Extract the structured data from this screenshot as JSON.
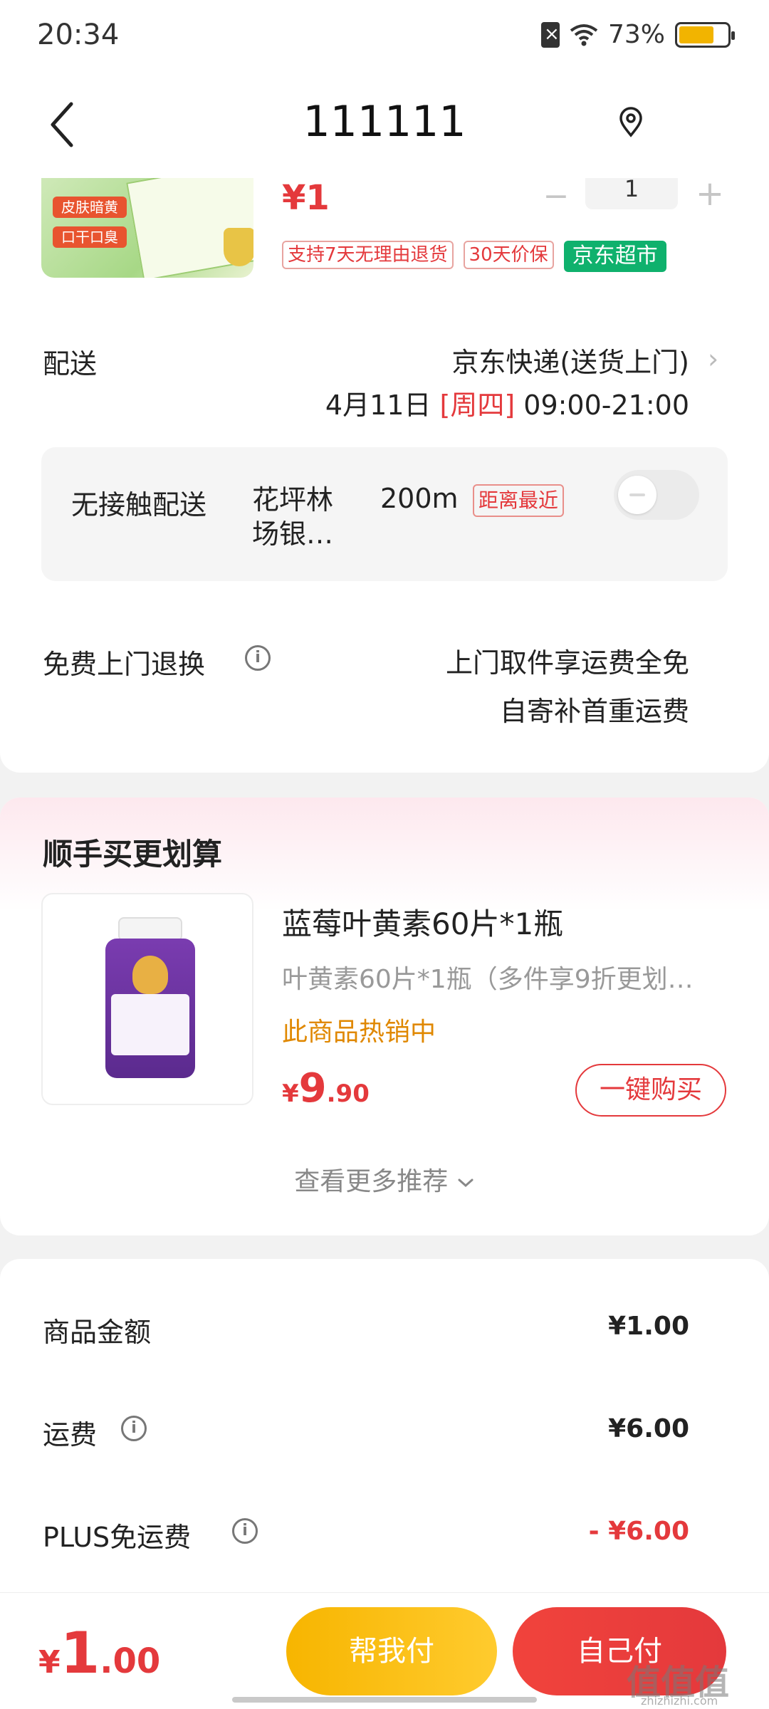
{
  "status_bar": {
    "time": "20:34",
    "battery": "73%",
    "battery_level": 0.73
  },
  "header": {
    "title": "111111"
  },
  "product": {
    "thumb_tags": [
      "皮肤暗黄",
      "口干口臭"
    ],
    "price": "¥1",
    "quantity": "1",
    "tags": [
      "支持7天无理由退货",
      "30天价保",
      "京东超市"
    ]
  },
  "shipping": {
    "label": "配送",
    "carrier": "京东快递(送货上门)",
    "date": "4月11日",
    "weekday": "[周四]",
    "time_range": "09:00-21:00"
  },
  "no_contact": {
    "title": "无接触配送",
    "place": "花坪林场银…",
    "distance": "200m",
    "badge": "距离最近",
    "enabled": false
  },
  "returns": {
    "label": "免费上门退换",
    "line1": "上门取件享运费全免",
    "line2": "自寄补首重运费"
  },
  "recommend": {
    "title": "顺手买更划算",
    "item": {
      "name": "蓝莓叶黄素60片*1瓶",
      "desc": "叶黄素60片*1瓶（多件享9折更划…",
      "hot": "此商品热销中",
      "price_symbol": "¥",
      "price_int": "9",
      "price_dec": ".90",
      "buy_label": "一键购买"
    },
    "more_label": "查看更多推荐"
  },
  "pricing": [
    {
      "label": "商品金额",
      "value": "¥1.00",
      "info": false,
      "red": false
    },
    {
      "label": "运费",
      "value": "¥6.00",
      "info": true,
      "red": false
    },
    {
      "label": "PLUS免运费",
      "value": "- ¥6.00",
      "info": true,
      "red": true
    }
  ],
  "bottom": {
    "total_symbol": "¥",
    "total_int": "1",
    "total_dec": ".00",
    "help_pay_label": "帮我付",
    "self_pay_label": "自己付",
    "watermark": "值值值",
    "watermark_sub": "zhizhizhi.com"
  },
  "colors": {
    "brand_red": "#e4393c",
    "jd_green": "#0fb16d",
    "help_yellow": "#f7b500",
    "hot_orange": "#e08800"
  }
}
